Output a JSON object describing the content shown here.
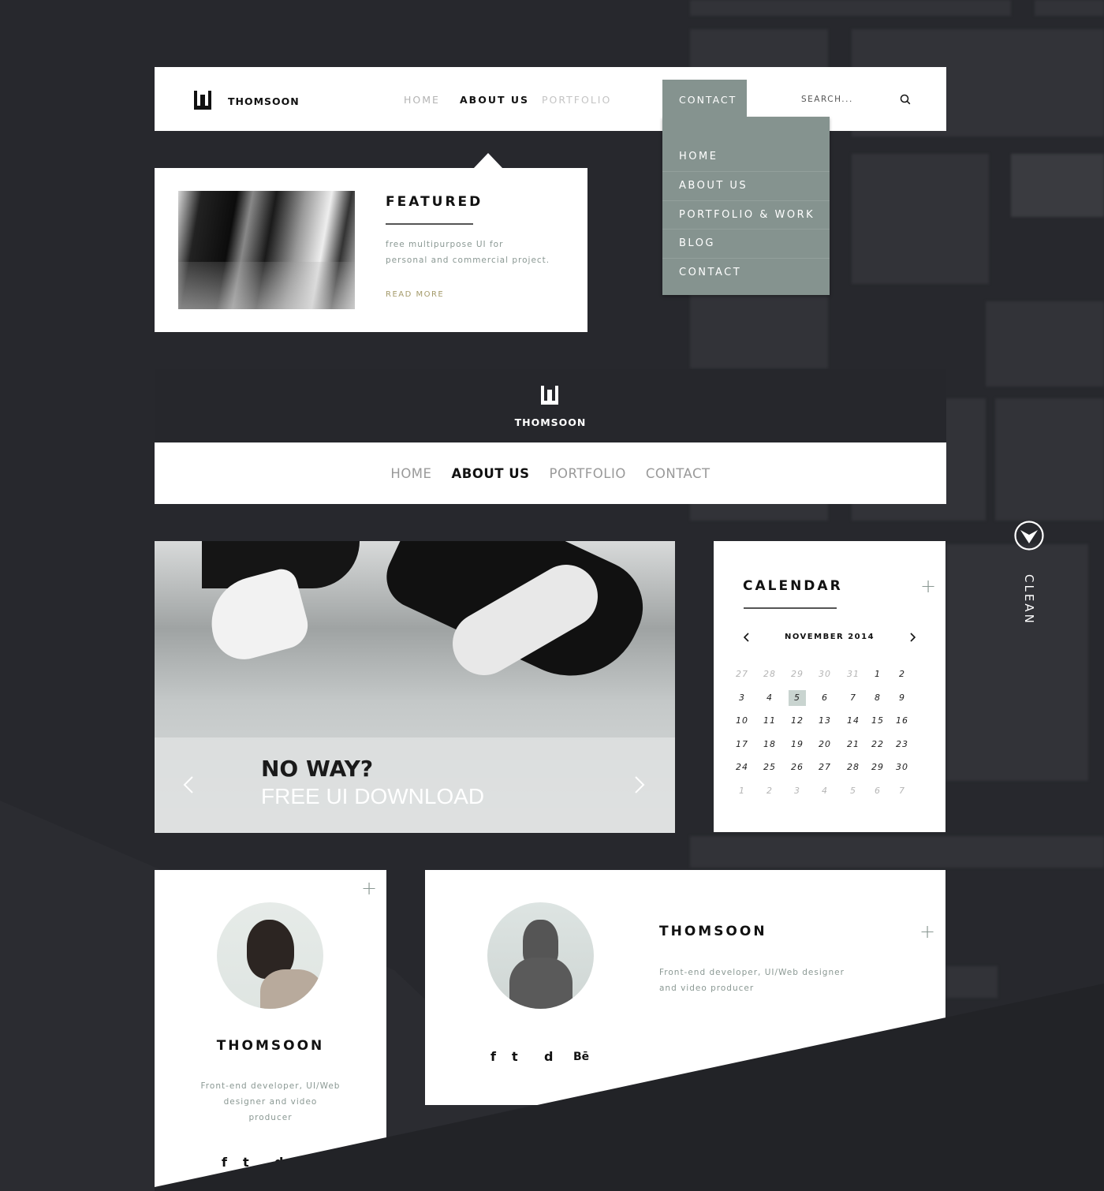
{
  "brand": {
    "name": "THOMSOON",
    "logo_icon": "thomsoon-logo-icon"
  },
  "header1": {
    "nav": [
      "HOME",
      "ABOUT US",
      "PORTFOLIO"
    ],
    "active": "ABOUT US",
    "contact_tab": "CONTACT",
    "search_placeholder": "SEARCH...",
    "dropdown": [
      "HOME",
      "ABOUT US",
      "PORTFOLIO & WORK",
      "BLOG",
      "CONTACT"
    ],
    "accent": "#85938f"
  },
  "featured": {
    "title": "FEATURED",
    "text_line1": "free multipurpose UI for",
    "text_line2": "personal and commercial project.",
    "link": "READ MORE",
    "link_color": "#a49a6a"
  },
  "header2": {
    "nav": [
      "HOME",
      "ABOUT US",
      "PORTFOLIO",
      "CONTACT"
    ],
    "active": "ABOUT US"
  },
  "slider": {
    "title": "NO WAY?",
    "subtitle": "FREE UI DOWNLOAD"
  },
  "calendar": {
    "title": "CALENDAR",
    "month": "NOVEMBER 2014",
    "selected": "5",
    "weeks": [
      [
        "27",
        "28",
        "29",
        "30",
        "31",
        "1",
        "2"
      ],
      [
        "3",
        "4",
        "5",
        "6",
        "7",
        "8",
        "9"
      ],
      [
        "10",
        "11",
        "12",
        "13",
        "14",
        "15",
        "16"
      ],
      [
        "17",
        "18",
        "19",
        "20",
        "21",
        "22",
        "23"
      ],
      [
        "24",
        "25",
        "26",
        "27",
        "28",
        "29",
        "30"
      ],
      [
        "1",
        "2",
        "3",
        "4",
        "5",
        "6",
        "7"
      ]
    ]
  },
  "side_badge": {
    "label": "CLEAN",
    "icon": "arrow-down-circle-icon"
  },
  "profile_vertical": {
    "name": "THOMSOON",
    "bio_line1": "Front-end developer, UI/Web",
    "bio_line2": "designer and video",
    "bio_line3": "producer",
    "social": [
      "f",
      "t",
      "d"
    ]
  },
  "profile_horizontal": {
    "name": "THOMSOON",
    "bio_line1": "Front-end developer, UI/Web designer",
    "bio_line2": "and video producer",
    "social": [
      "f",
      "t",
      "d",
      "Bē"
    ]
  }
}
